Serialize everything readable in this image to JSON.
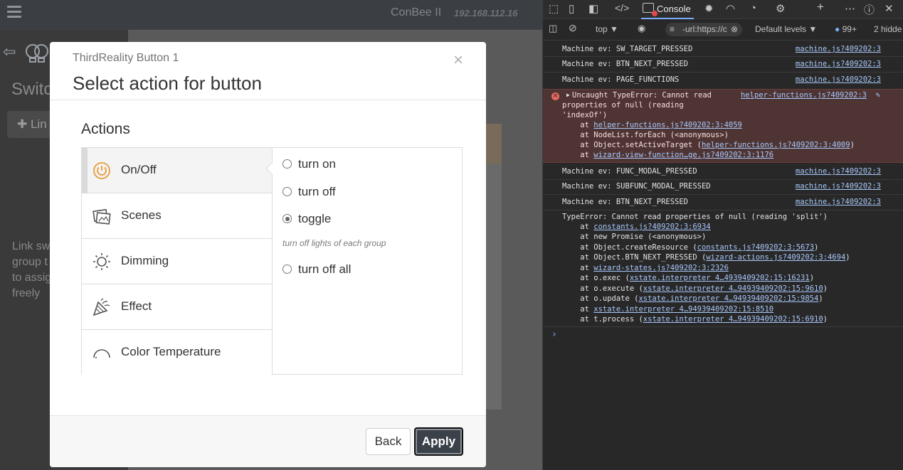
{
  "app": {
    "brand": "ConBee II",
    "ip": "192.168.112.16",
    "side_title": "Switc",
    "link_button": "Lin",
    "side_description": "Link sw group t to assig freely"
  },
  "modal": {
    "subtitle": "ThirdReality Button 1",
    "title": "Select action for button",
    "close_symbol": "×",
    "actions_heading": "Actions",
    "actions": [
      {
        "label": "On/Off",
        "icon": "power-icon",
        "selected": true
      },
      {
        "label": "Scenes",
        "icon": "scenes-icon",
        "selected": false
      },
      {
        "label": "Dimming",
        "icon": "sun-icon",
        "selected": false
      },
      {
        "label": "Effect",
        "icon": "party-popper-icon",
        "selected": false
      },
      {
        "label": "Color Temperature",
        "icon": "gauge-icon",
        "selected": false
      }
    ],
    "options": [
      {
        "label": "turn on",
        "checked": false
      },
      {
        "label": "turn off",
        "checked": false
      },
      {
        "label": "toggle",
        "checked": true
      },
      {
        "label": "turn off all",
        "checked": false
      }
    ],
    "hint": "turn off lights of each group",
    "back_label": "Back",
    "apply_label": "Apply"
  },
  "devtools": {
    "console_tab": "Console",
    "context": "top",
    "filter": "-url:https://c",
    "levels": "Default levels",
    "message_count": "99+",
    "hidden": "2 hidde",
    "log": [
      {
        "text": "Machine ev: SW_TARGET_PRESSED",
        "src": "machine.js?409202:3"
      },
      {
        "text": "Machine ev: BTN_NEXT_PRESSED",
        "src": "machine.js?409202:3"
      },
      {
        "text": "Machine ev: PAGE_FUNCTIONS",
        "src": "machine.js?409202:3"
      }
    ],
    "error": {
      "line1": "Uncaught TypeError: Cannot read",
      "line2": "properties of null (reading",
      "line3": "'indexOf')",
      "src": "helper-functions.js?409202:3",
      "stack": [
        {
          "pre": "    at ",
          "link": "helper-functions.js?409202:3:4059",
          "post": ""
        },
        {
          "pre": "    at NodeList.forEach (<anonymous>)",
          "link": "",
          "post": ""
        },
        {
          "pre": "    at Object.setActiveTarget (",
          "link": "helper-functions.js?409202:3:4009",
          "post": ")"
        },
        {
          "pre": "    at ",
          "link": "wizard-view-function…ge.js?409202:3:1176",
          "post": ""
        }
      ]
    },
    "log2": [
      {
        "text": "Machine ev: FUNC_MODAL_PRESSED",
        "src": "machine.js?409202:3"
      },
      {
        "text": "Machine ev: SUBFUNC_MODAL_PRESSED",
        "src": "machine.js?409202:3"
      },
      {
        "text": "Machine ev: BTN_NEXT_PRESSED",
        "src": "machine.js?409202:3"
      }
    ],
    "type_error": "TypeError: Cannot read properties of null (reading 'split')",
    "type_error_stack": [
      {
        "pre": "    at ",
        "link": "constants.js?409202:3:6934",
        "post": ""
      },
      {
        "pre": "    at new Promise (<anonymous>)",
        "link": "",
        "post": ""
      },
      {
        "pre": "    at Object.createResource (",
        "link": "constants.js?409202:3:5673",
        "post": ")"
      },
      {
        "pre": "    at Object.BTN_NEXT_PRESSED (",
        "link": "wizard-actions.js?409202:3:4694",
        "post": ")"
      },
      {
        "pre": "    at ",
        "link": "wizard-states.js?409202:3:2326",
        "post": ""
      },
      {
        "pre": "    at o.exec (",
        "link": "xstate.interpreter 4…4939409202:15:16231",
        "post": ")"
      },
      {
        "pre": "    at o.execute (",
        "link": "xstate.interpreter 4…94939409202:15:9610",
        "post": ")"
      },
      {
        "pre": "    at o.update (",
        "link": "xstate.interpreter 4…94939409202:15:9854",
        "post": ")"
      },
      {
        "pre": "    at ",
        "link": "xstate.interpreter 4…94939409202:15:8510",
        "post": ""
      },
      {
        "pre": "    at t.process (",
        "link": "xstate.interpreter 4…94939409202:15:6910",
        "post": ")"
      }
    ],
    "prompt": "›"
  },
  "colors": {
    "accent_icon": "#e8a24a",
    "error_bg": "#4e3534",
    "link": "#a8c7fa"
  }
}
